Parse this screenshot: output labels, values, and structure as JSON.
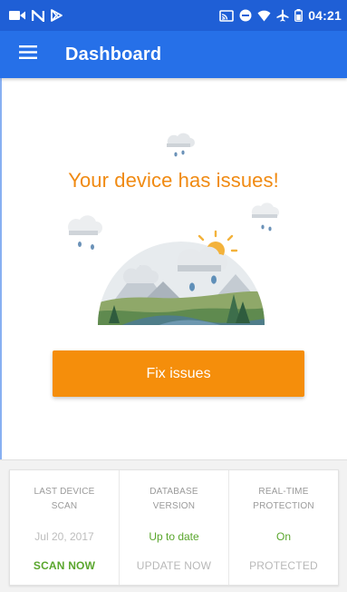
{
  "status_bar": {
    "time": "04:21",
    "left_icons": [
      "video-icon",
      "n-icon",
      "play-store-icon"
    ],
    "right_icons": [
      "cast-icon",
      "do-not-disturb-icon",
      "wifi-icon",
      "airplane-icon",
      "battery-icon"
    ]
  },
  "app_bar": {
    "title": "Dashboard",
    "menu_icon": "hamburger-menu-icon"
  },
  "hero": {
    "headline": "Your device has issues!",
    "illustration": "rainy-landscape"
  },
  "fix_button": {
    "label": "Fix issues"
  },
  "stats": [
    {
      "label": "LAST DEVICE SCAN",
      "value": "Jul 20, 2017",
      "action": "SCAN NOW"
    },
    {
      "label": "DATABASE VERSION",
      "value": "Up to date",
      "action": "UPDATE NOW"
    },
    {
      "label": "REAL-TIME PROTECTION",
      "value": "On",
      "action": "PROTECTED"
    }
  ],
  "colors": {
    "status_bar": "#1f5fd6",
    "app_bar": "#2670e8",
    "accent_orange": "#f58e0b",
    "headline_orange": "#f08a12",
    "success_green": "#5aa62d",
    "muted_gray": "#b8b8b8"
  }
}
